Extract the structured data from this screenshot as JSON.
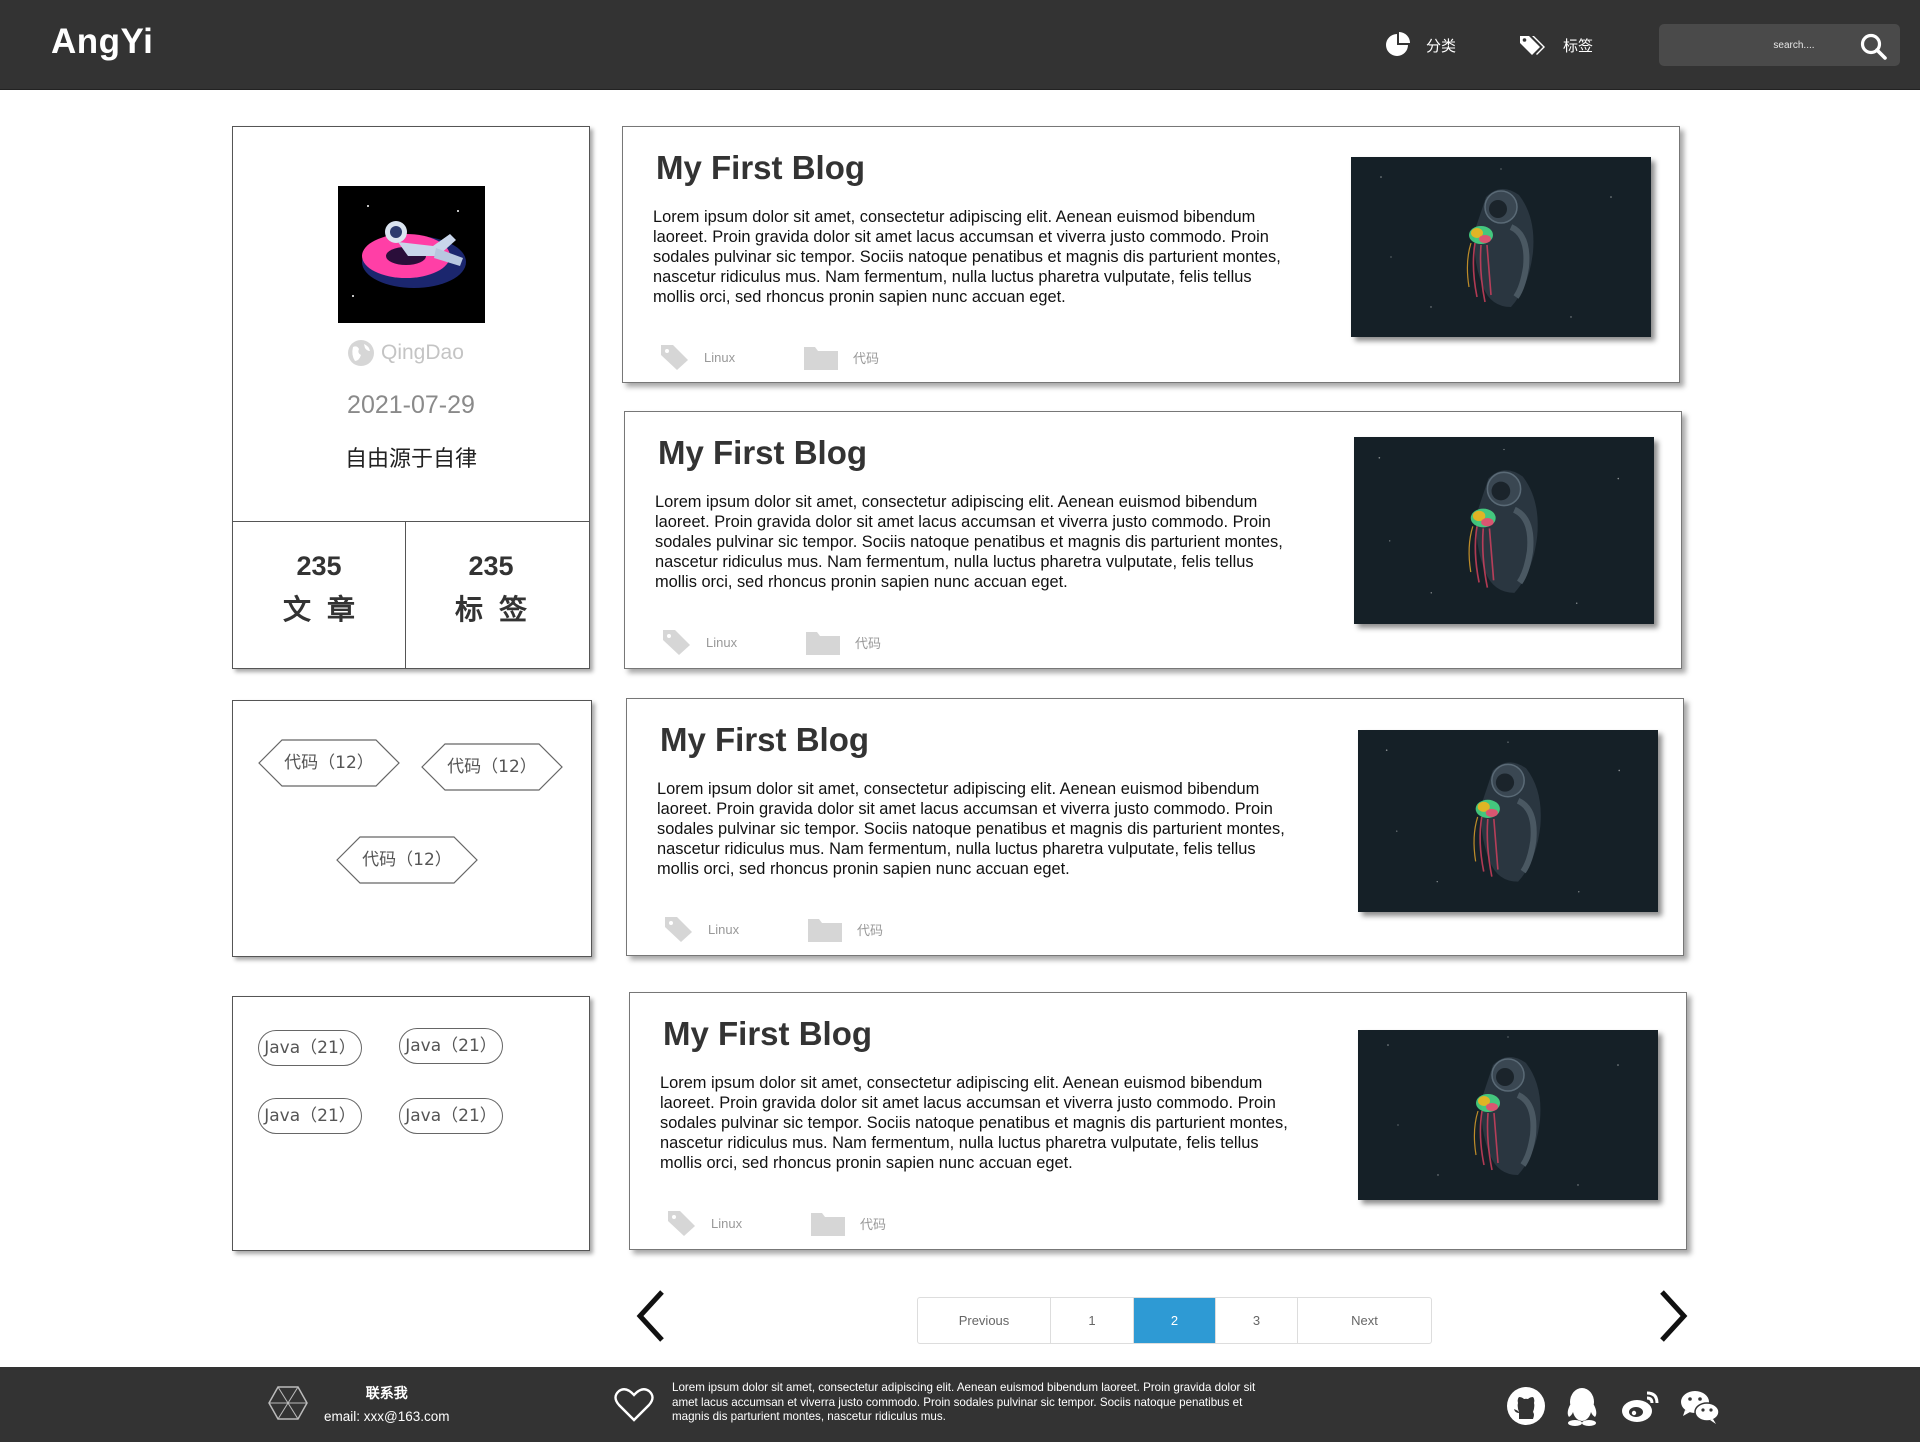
{
  "header": {
    "brand": "AngYi",
    "nav": [
      {
        "label": "分类",
        "icon": "pie-chart-icon"
      },
      {
        "label": "标签",
        "icon": "tags-icon"
      }
    ],
    "search_placeholder": "search....",
    "search_icon": "search-icon"
  },
  "profile": {
    "location": "QingDao",
    "date": "2021-07-29",
    "motto": "自由源于自律",
    "stats": [
      {
        "value": "235",
        "label": "文章"
      },
      {
        "value": "235",
        "label": "标签"
      }
    ]
  },
  "tag_cloud": [
    "代码（12）",
    "代码（12）",
    "代码（12）"
  ],
  "categories": [
    "Java（21）",
    "Java（21）",
    "Java（21）",
    "Java（21）"
  ],
  "posts": [
    {
      "title": "My First Blog",
      "body": "Lorem ipsum dolor sit amet, consectetur adipiscing elit. Aenean euismod bibendum laoreet. Proin gravida dolor sit amet lacus accumsan et viverra justo commodo. Proin sodales pulvinar sic tempor. Sociis natoque penatibus et magnis dis parturient montes, nascetur ridiculus mus. Nam fermentum, nulla luctus pharetra vulputate, felis tellus mollis orci, sed rhoncus pronin sapien nunc accuan eget.",
      "tag": "Linux",
      "category": "代码"
    },
    {
      "title": "My First Blog",
      "body": "Lorem ipsum dolor sit amet, consectetur adipiscing elit. Aenean euismod bibendum laoreet. Proin gravida dolor sit amet lacus accumsan et viverra justo commodo. Proin sodales pulvinar sic tempor. Sociis natoque penatibus et magnis dis parturient montes, nascetur ridiculus mus. Nam fermentum, nulla luctus pharetra vulputate, felis tellus mollis orci, sed rhoncus pronin sapien nunc accuan eget.",
      "tag": "Linux",
      "category": "代码"
    },
    {
      "title": "My First Blog",
      "body": "Lorem ipsum dolor sit amet, consectetur adipiscing elit. Aenean euismod bibendum laoreet. Proin gravida dolor sit amet lacus accumsan et viverra justo commodo. Proin sodales pulvinar sic tempor. Sociis natoque penatibus et magnis dis parturient montes, nascetur ridiculus mus. Nam fermentum, nulla luctus pharetra vulputate, felis tellus mollis orci, sed rhoncus pronin sapien nunc accuan eget.",
      "tag": "Linux",
      "category": "代码"
    },
    {
      "title": "My First Blog",
      "body": "Lorem ipsum dolor sit amet, consectetur adipiscing elit. Aenean euismod bibendum laoreet. Proin gravida dolor sit amet lacus accumsan et viverra justo commodo. Proin sodales pulvinar sic tempor. Sociis natoque penatibus et magnis dis parturient montes, nascetur ridiculus mus. Nam fermentum, nulla luctus pharetra vulputate, felis tellus mollis orci, sed rhoncus pronin sapien nunc accuan eget.",
      "tag": "Linux",
      "category": "代码"
    }
  ],
  "pagination": {
    "previous": "Previous",
    "pages": [
      "1",
      "2",
      "3"
    ],
    "active": "2",
    "next": "Next"
  },
  "footer": {
    "contact_title": "联系我",
    "email": "email: xxx@163.com",
    "text": "Lorem ipsum dolor sit amet, consectetur adipiscing elit. Aenean euismod bibendum laoreet. Proin gravida dolor sit amet lacus accumsan et viverra justo commodo. Proin sodales pulvinar sic tempor. Sociis natoque penatibus et magnis dis parturient montes, nascetur ridiculus mus.",
    "social": [
      "github-icon",
      "qq-icon",
      "weibo-icon",
      "wechat-icon"
    ]
  },
  "colors": {
    "header_bg": "#333333",
    "footer_bg": "#333333",
    "pager_active": "#2e9ad4"
  }
}
